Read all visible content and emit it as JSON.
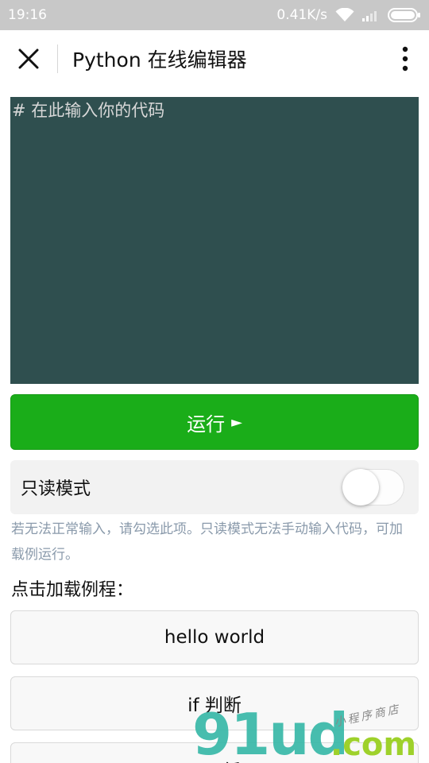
{
  "status_bar": {
    "time": "19:16",
    "network_speed": "0.41K/s"
  },
  "header": {
    "title": "Python 在线编辑器",
    "close_icon": "close-icon",
    "more_icon": "more-vertical-icon"
  },
  "editor": {
    "placeholder": "# 在此输入你的代码",
    "value": "",
    "background_color": "#2f4f4f"
  },
  "run_button": {
    "label": "运行",
    "icon": "►",
    "color": "#1aad19"
  },
  "readonly": {
    "label": "只读模式",
    "enabled": false
  },
  "hint": "若无法正常输入，请勾选此项。只读模式无法手动输入代码，可加载例运行。",
  "examples": {
    "heading": "点击加载例程：",
    "items": [
      "hello world",
      "if 判断",
      "while 循环"
    ]
  },
  "watermark": {
    "brand": "91ud",
    "suffix": ".com",
    "tagline": "小程序商店"
  }
}
